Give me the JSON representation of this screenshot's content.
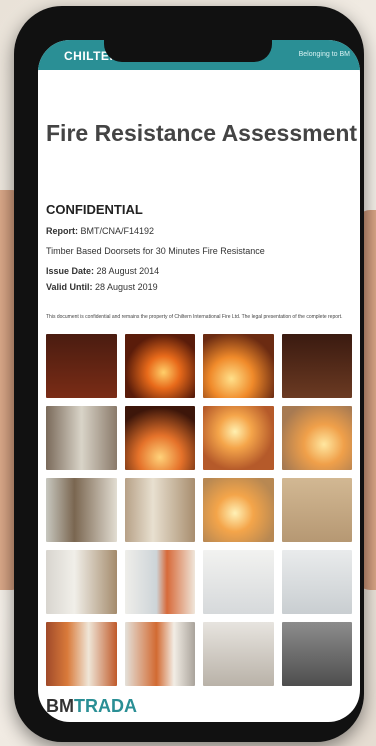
{
  "app": {
    "brand_left": "CHILTERN",
    "brand_right": "Belonging to BM"
  },
  "document": {
    "title": "Fire Resistance Assessment",
    "confidential": "CONFIDENTIAL",
    "report_label": "Report:",
    "report_value": "BMT/CNA/F14192",
    "subject": "Timber Based Doorsets for 30 Minutes Fire Resistance",
    "issue_label": "Issue Date:",
    "issue_value": "28 August 2014",
    "valid_label": "Valid Until:",
    "valid_value": "28 August 2019",
    "disclaimer": "This document is confidential and remains the property of Chiltern International Fire Ltd. The legal presentation of the complete report."
  },
  "footer": {
    "logo_part1": "BM",
    "logo_part2": "TRADA"
  },
  "colors": {
    "accent": "#2a8f95",
    "text_primary": "#333333",
    "title": "#444444"
  },
  "gallery": {
    "tile_count": 20
  }
}
